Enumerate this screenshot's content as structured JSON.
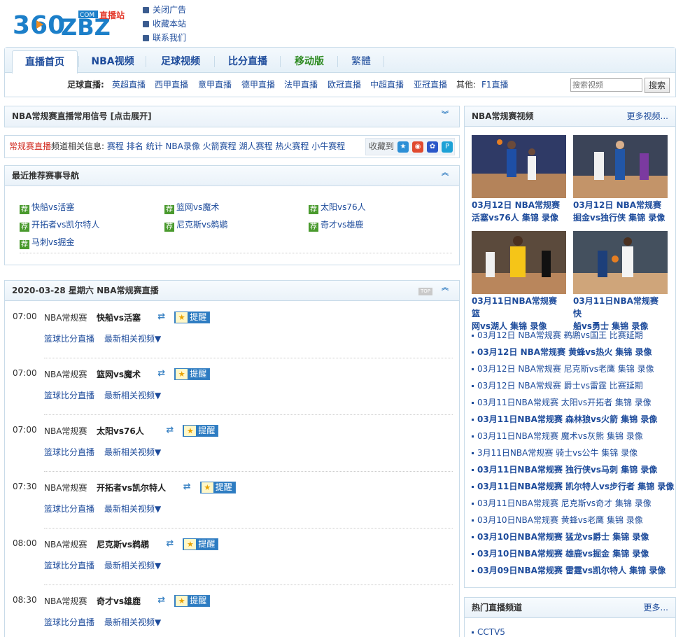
{
  "header": {
    "logo_text": "360ZBZ",
    "logo_com": ".COM",
    "logo_tag": "直播站",
    "top_links": [
      "关闭广告",
      "收藏本站",
      "联系我们"
    ]
  },
  "nav": {
    "tabs": [
      "直播首页",
      "NBA视频",
      "足球视频",
      "比分直播",
      "移动版",
      "繁體"
    ],
    "football_label": "足球直播:",
    "football_links": [
      "英超直播",
      "西甲直播",
      "意甲直播",
      "德甲直播",
      "法甲直播",
      "欧冠直播",
      "中超直播",
      "亚冠直播"
    ],
    "other_label": "其他:",
    "other_links": [
      "F1直播"
    ],
    "search_placeholder": "搜索视频",
    "search_button": "搜索"
  },
  "signal_panel": {
    "title": "NBA常规赛直播常用信号 [点击展开]"
  },
  "infobar": {
    "red_text": "常规赛直播",
    "text": "频道相关信息:",
    "links": [
      "赛程",
      "排名",
      "统计",
      "NBA录像",
      "火箭赛程",
      "湖人赛程",
      "热火赛程",
      "小牛赛程"
    ],
    "fav_label": "收藏到"
  },
  "recommend": {
    "title": "最近推荐赛事导航",
    "badge": "荐",
    "items": [
      "快船vs活塞",
      "篮网vs魔术",
      "太阳vs76人",
      "开拓者vs凯尔特人",
      "尼克斯vs鹈鹕",
      "奇才vs雄鹿",
      "马刺vs掘金"
    ]
  },
  "schedule": {
    "title": "2020-03-28 星期六 NBA常规赛直播",
    "top_badge": "TOP",
    "remind_label": "提醒",
    "link_score": "篮球比分直播",
    "link_videos": "最新相关视频▼",
    "matches": [
      {
        "time": "07:00",
        "league": "NBA常规赛",
        "name": "快船vs活塞"
      },
      {
        "time": "07:00",
        "league": "NBA常规赛",
        "name": "篮网vs魔术"
      },
      {
        "time": "07:00",
        "league": "NBA常规赛",
        "name": "太阳vs76人"
      },
      {
        "time": "07:30",
        "league": "NBA常规赛",
        "name": "开拓者vs凯尔特人"
      },
      {
        "time": "08:00",
        "league": "NBA常规赛",
        "name": "尼克斯vs鹈鹕"
      },
      {
        "time": "08:30",
        "league": "NBA常规赛",
        "name": "奇才vs雄鹿"
      }
    ]
  },
  "videos": {
    "title": "NBA常规赛视频",
    "more": "更多视频...",
    "featured": [
      {
        "line1": "03月12日 NBA常规赛",
        "line2": "活塞vs76人 集锦 录像"
      },
      {
        "line1": "03月12日 NBA常规赛",
        "line2": "掘金vs独行侠 集锦 录像"
      },
      {
        "line1": "03月11日NBA常规赛 篮",
        "line2": "网vs湖人 集锦 录像"
      },
      {
        "line1": "03月11日NBA常规赛 快",
        "line2": "船vs勇士 集锦 录像"
      }
    ],
    "list": [
      {
        "text": "03月12日 NBA常规赛 鹈鹕vs国王 比赛延期",
        "bold": false
      },
      {
        "text": "03月12日 NBA常规赛 黄蜂vs热火 集锦 录像",
        "bold": true
      },
      {
        "text": "03月12日 NBA常规赛 尼克斯vs老鹰 集锦 录像",
        "bold": false
      },
      {
        "text": "03月12日 NBA常规赛 爵士vs雷霆 比赛延期",
        "bold": false
      },
      {
        "text": "03月11日NBA常规赛 太阳vs开拓者 集锦 录像",
        "bold": false
      },
      {
        "text": "03月11日NBA常规赛 森林狼vs火箭 集锦 录像",
        "bold": true
      },
      {
        "text": "03月11日NBA常规赛 魔术vs灰熊 集锦 录像",
        "bold": false
      },
      {
        "text": "3月11日NBA常规赛 骑士vs公牛 集锦 录像",
        "bold": false
      },
      {
        "text": "03月11日NBA常规赛 独行侠vs马刺 集锦 录像",
        "bold": true
      },
      {
        "text": "03月11日NBA常规赛 凯尔特人vs步行者 集锦 录像",
        "bold": true
      },
      {
        "text": "03月11日NBA常规赛 尼克斯vs奇才 集锦 录像",
        "bold": false
      },
      {
        "text": "03月10日NBA常规赛 黄蜂vs老鹰 集锦 录像",
        "bold": false
      },
      {
        "text": "03月10日NBA常规赛 猛龙vs爵士 集锦 录像",
        "bold": true
      },
      {
        "text": "03月10日NBA常规赛 雄鹿vs掘金 集锦 录像",
        "bold": true
      },
      {
        "text": "03月09日NBA常规赛 雷霆vs凯尔特人 集锦 录像",
        "bold": true
      }
    ]
  },
  "hot": {
    "title": "热门直播频道",
    "more": "更多...",
    "items": [
      "CCTV5"
    ]
  }
}
